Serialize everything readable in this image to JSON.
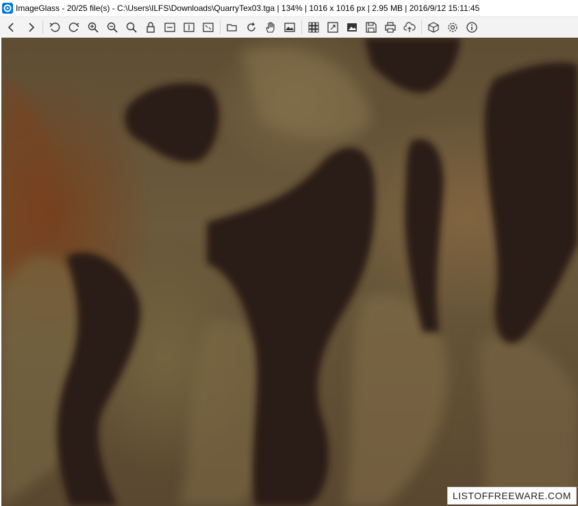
{
  "window": {
    "title": "ImageGlass - 20/25 file(s) - C:\\Users\\ILFS\\Downloads\\QuarryTex03.tga  |  134%  |  1016 x 1016 px  |  2.95 MB  |  2016/9/12 15:11:45"
  },
  "toolbar": {
    "buttons": [
      {
        "icon": "chevron-left-icon",
        "label": "Previous image"
      },
      {
        "icon": "chevron-right-icon",
        "label": "Next image"
      },
      {
        "icon": "rotate-left-icon",
        "label": "Rotate left"
      },
      {
        "icon": "rotate-right-icon",
        "label": "Rotate right"
      },
      {
        "icon": "zoom-in-icon",
        "label": "Zoom in"
      },
      {
        "icon": "zoom-out-icon",
        "label": "Zoom out"
      },
      {
        "icon": "actual-size-icon",
        "label": "Actual size"
      },
      {
        "icon": "lock-zoom-icon",
        "label": "Lock zoom"
      },
      {
        "icon": "scale-width-icon",
        "label": "Scale to width"
      },
      {
        "icon": "scale-height-icon",
        "label": "Scale to height"
      },
      {
        "icon": "auto-zoom-icon",
        "label": "Auto zoom"
      },
      {
        "icon": "open-folder-icon",
        "label": "Open file"
      },
      {
        "icon": "refresh-icon",
        "label": "Refresh"
      },
      {
        "icon": "pan-hand-icon",
        "label": "Go to image"
      },
      {
        "icon": "thumbnail-icon",
        "label": "Thumbnail bar"
      },
      {
        "icon": "grid-icon",
        "label": "Checkerboard"
      },
      {
        "icon": "fullscreen-icon",
        "label": "Full screen"
      },
      {
        "icon": "slideshow-icon",
        "label": "Slideshow"
      },
      {
        "icon": "save-icon",
        "label": "Save"
      },
      {
        "icon": "print-icon",
        "label": "Print"
      },
      {
        "icon": "upload-icon",
        "label": "Upload"
      },
      {
        "icon": "extension-box-icon",
        "label": "Extensions"
      },
      {
        "icon": "settings-gear-icon",
        "label": "Settings"
      },
      {
        "icon": "info-icon",
        "label": "About"
      }
    ]
  },
  "viewer": {
    "image_description": "QuarryTex03.tga"
  },
  "watermark": {
    "text": "LISTOFFREEWARE.COM"
  },
  "colors": {
    "accent": "#0078d7",
    "toolbar_bg": "#f3f3f3",
    "icon": "#333333"
  }
}
